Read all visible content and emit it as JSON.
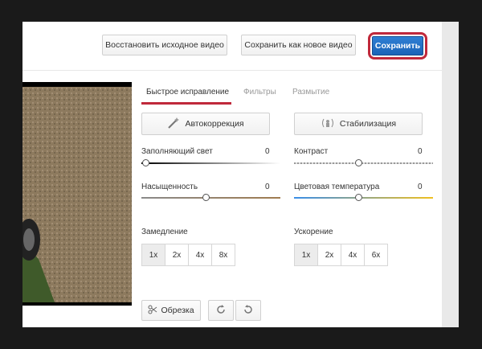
{
  "toolbar": {
    "restore_label": "Восстановить исходное видео",
    "save_new_label": "Сохранить как новое видео",
    "save_label": "Сохранить"
  },
  "tabs": [
    {
      "label": "Быстрое исправление",
      "active": true
    },
    {
      "label": "Фильтры",
      "active": false
    },
    {
      "label": "Размытие",
      "active": false
    }
  ],
  "actions": {
    "autocorrect_label": "Автокоррекция",
    "stabilize_label": "Стабилизация"
  },
  "adjust": {
    "fill_light": {
      "label": "Заполняющий свет",
      "value": "0",
      "level": 0.0
    },
    "contrast": {
      "label": "Контраст",
      "value": "0",
      "level": 0.5
    },
    "saturation": {
      "label": "Насыщенность",
      "value": "0",
      "level": 0.5
    },
    "color_temp": {
      "label": "Цветовая температура",
      "value": "0",
      "level": 0.5
    }
  },
  "slowdown": {
    "label": "Замедление",
    "options": [
      "1x",
      "2x",
      "4x",
      "8x"
    ],
    "selected": "1x"
  },
  "speedup": {
    "label": "Ускорение",
    "options": [
      "1x",
      "2x",
      "4x",
      "6x"
    ],
    "selected": "1x"
  },
  "bottom": {
    "crop_label": "Обрезка"
  },
  "icons": [
    "magic-wand-icon",
    "stabilize-icon",
    "scissors-icon",
    "rotate-right-icon",
    "rotate-left-icon"
  ]
}
